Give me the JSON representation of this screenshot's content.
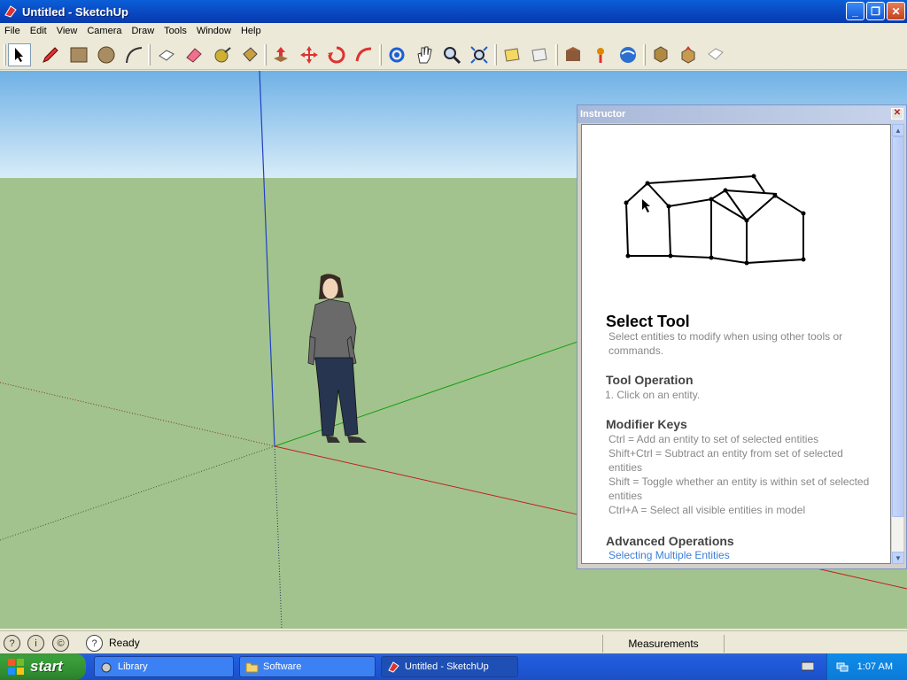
{
  "window": {
    "title": "Untitled - SketchUp"
  },
  "menu": [
    "File",
    "Edit",
    "View",
    "Camera",
    "Draw",
    "Tools",
    "Window",
    "Help"
  ],
  "toolbar": {
    "tools": [
      "select",
      "pencil",
      "rectangle",
      "circle",
      "arc",
      "make-component",
      "eraser",
      "tape-measure",
      "paint-bucket",
      "push-pull",
      "move",
      "rotate",
      "follow-me",
      "orbit",
      "pan",
      "zoom",
      "zoom-extents",
      "previous-view",
      "next-view",
      "warehouse",
      "add-location",
      "google-earth",
      "get-models",
      "share-model",
      "make-component-2"
    ]
  },
  "instructor": {
    "title": "Instructor",
    "heading": "Select Tool",
    "description": "Select entities to modify when using other tools or commands.",
    "tool_operation_heading": "Tool Operation",
    "tool_operation_step": "1.   Click on an entity.",
    "modifier_heading": "Modifier Keys",
    "modifiers": [
      "Ctrl = Add an entity to set of selected entities",
      "Shift+Ctrl = Subtract an entity from set of selected entities",
      "Shift = Toggle whether an entity is within set of selected entities",
      "Ctrl+A = Select all visible entities in model"
    ],
    "advanced_heading": "Advanced Operations",
    "advanced_link": "Selecting Multiple Entities"
  },
  "status": {
    "text": "Ready",
    "measurements_label": "Measurements"
  },
  "taskbar": {
    "start_label": "start",
    "tasks": [
      "Library",
      "Software",
      "Untitled - SketchUp"
    ],
    "clock": "1:07 AM"
  },
  "colors": {
    "sky": "#b8d8f0",
    "ground": "#a3c38e",
    "xp_blue": "#245edb",
    "accent_red": "#cc2222"
  }
}
